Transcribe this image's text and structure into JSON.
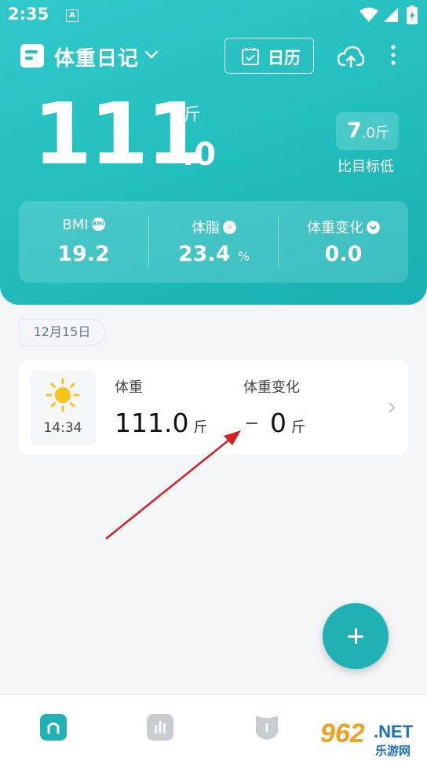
{
  "status_bar": {
    "time": "2:35",
    "notification_icon_text": "A"
  },
  "title_bar": {
    "title": "体重日记",
    "calendar_label": "日历"
  },
  "summary": {
    "weight_integer": "111",
    "weight_unit": "斤",
    "weight_decimal": ".0",
    "goal_diff_value": "7",
    "goal_diff_decimal": ".0斤",
    "goal_diff_text": "比目标低"
  },
  "stats": [
    {
      "label": "BMI",
      "value": "19.2",
      "unit": "",
      "icon": "bmi-icon",
      "icon_text": "BMI"
    },
    {
      "label": "体脂",
      "value": "23.4",
      "unit": "%",
      "icon": "bodyfat-icon",
      "icon_text": ""
    },
    {
      "label": "体重变化",
      "value": "0.0",
      "unit": "",
      "icon": "chevron-down-icon",
      "icon_text": ""
    }
  ],
  "records": {
    "date": "12月15日",
    "items": [
      {
        "time": "14:34",
        "weight_label": "体重",
        "weight_value": "111.0",
        "weight_unit": "斤",
        "change_label": "体重变化",
        "change_value": "0",
        "change_unit": "斤"
      }
    ]
  },
  "watermark": {
    "main": "962",
    "suffix": ".NET",
    "sub": "乐游网"
  },
  "colors": {
    "primary": "#22bdbd",
    "fab": "#1fb1b3",
    "background": "#f3f5f7"
  }
}
